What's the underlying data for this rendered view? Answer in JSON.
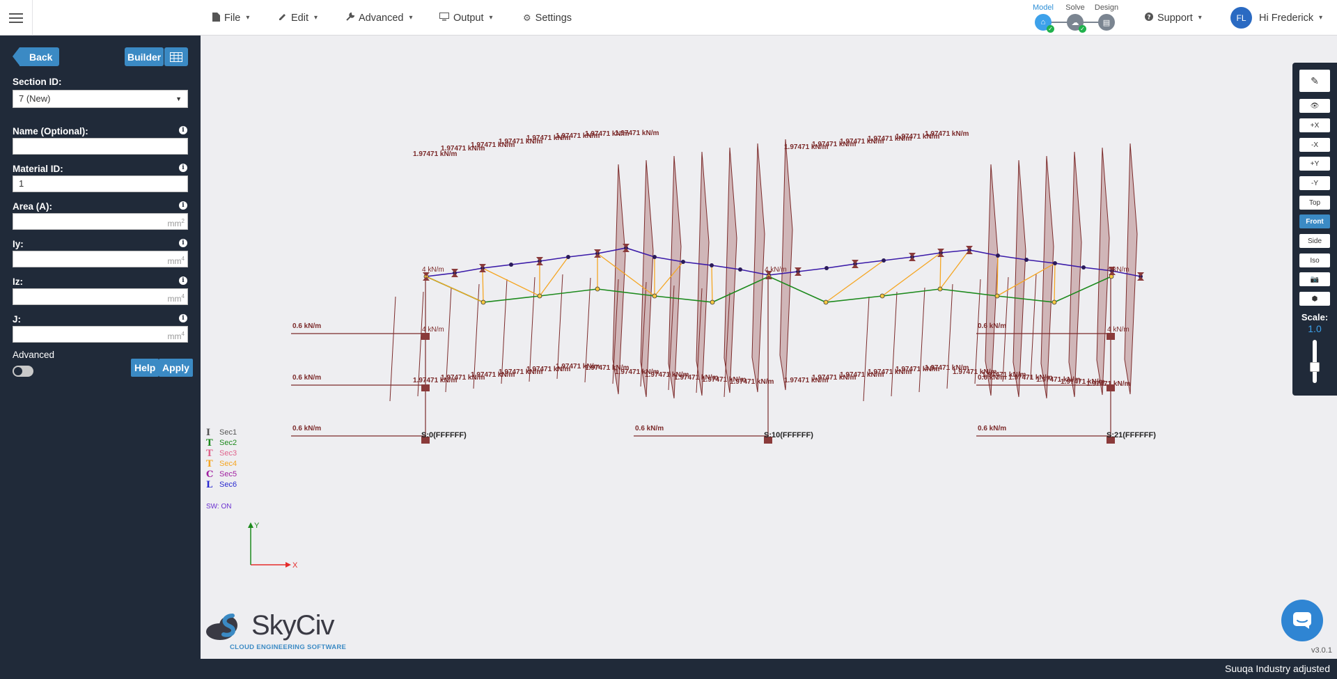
{
  "nav": {
    "menu_icon": "hamburger-icon",
    "items": [
      {
        "label": "File",
        "icon": "file-icon"
      },
      {
        "label": "Edit",
        "icon": "pencil-icon"
      },
      {
        "label": "Advanced",
        "icon": "wrench-icon"
      },
      {
        "label": "Output",
        "icon": "monitor-icon"
      },
      {
        "label": "Settings",
        "icon": "gear-icon"
      }
    ],
    "steps": [
      {
        "label": "Model",
        "active": true
      },
      {
        "label": "Solve",
        "active": false
      },
      {
        "label": "Design",
        "active": false
      }
    ],
    "support_label": "Support",
    "user_initials": "FL",
    "user_greeting": "Hi Frederick"
  },
  "sidebar": {
    "back_label": "Back",
    "builder_label": "Builder",
    "section_id_label": "Section ID:",
    "section_id_value": "7 (New)",
    "name_label": "Name (Optional):",
    "name_value": "",
    "material_label": "Material ID:",
    "material_value": "1",
    "area_label": "Area (A):",
    "area_unit": "mm",
    "area_unit_exp": "2",
    "iy_label": "Iy:",
    "iy_unit": "mm",
    "iy_unit_exp": "4",
    "iz_label": "Iz:",
    "iz_unit": "mm",
    "iz_unit_exp": "4",
    "j_label": "J:",
    "j_unit": "mm",
    "j_unit_exp": "4",
    "advanced_label": "Advanced",
    "advanced_on": false,
    "help_label": "Help",
    "apply_label": "Apply"
  },
  "legend": {
    "items": [
      {
        "glyph": "I",
        "label": "Sec1",
        "color": "#555555"
      },
      {
        "glyph": "T",
        "label": "Sec2",
        "color": "#1d8a1d"
      },
      {
        "glyph": "T",
        "label": "Sec3",
        "color": "#e0648c"
      },
      {
        "glyph": "T",
        "label": "Sec4",
        "color": "#f5a623"
      },
      {
        "glyph": "C",
        "label": "Sec5",
        "color": "#a020a0"
      },
      {
        "glyph": "L",
        "label": "Sec6",
        "color": "#2a2ad0"
      }
    ],
    "sw_status": "SW: ON"
  },
  "model": {
    "udl_label": "1.97471 kN/m",
    "wind_label": "0.6 kN/m",
    "point_label": "4 kN/m",
    "support_label_1": "S:0(FFFFFF)",
    "support_label_2": "S:10(FFFFFF)",
    "support_label_3": "S:21(FFFFFF)",
    "colors": {
      "load": "#7b2a2a",
      "load_fill": "#b88888",
      "top_chord": "#3a1aa8",
      "bottom_chord": "#1d8a1d",
      "web": "#f5a623",
      "column": "#7b2a2a"
    }
  },
  "axes": {
    "x_label": "X",
    "y_label": "Y",
    "x_color": "#e52b2b",
    "y_color": "#1d8a1d"
  },
  "toolbar": {
    "buttons": [
      {
        "label": "✎",
        "name": "pencil-button"
      },
      {
        "label": "👁",
        "name": "eye-button"
      },
      {
        "label": "+X",
        "name": "view-plus-x-button"
      },
      {
        "label": "-X",
        "name": "view-minus-x-button"
      },
      {
        "label": "+Y",
        "name": "view-plus-y-button"
      },
      {
        "label": "-Y",
        "name": "view-minus-y-button"
      },
      {
        "label": "Top",
        "name": "view-top-button"
      },
      {
        "label": "Front",
        "name": "view-front-button",
        "active": true
      },
      {
        "label": "Side",
        "name": "view-side-button"
      },
      {
        "label": "Iso",
        "name": "view-iso-button"
      },
      {
        "label": "📷",
        "name": "camera-button"
      },
      {
        "label": "⬢",
        "name": "cube-button"
      }
    ],
    "scale_label": "Scale:",
    "scale_value": "1.0"
  },
  "branding": {
    "name": "SkyCiv",
    "tagline": "CLOUD ENGINEERING SOFTWARE"
  },
  "version": "v3.0.1",
  "footer_text": "Suuqa Industry adjusted"
}
